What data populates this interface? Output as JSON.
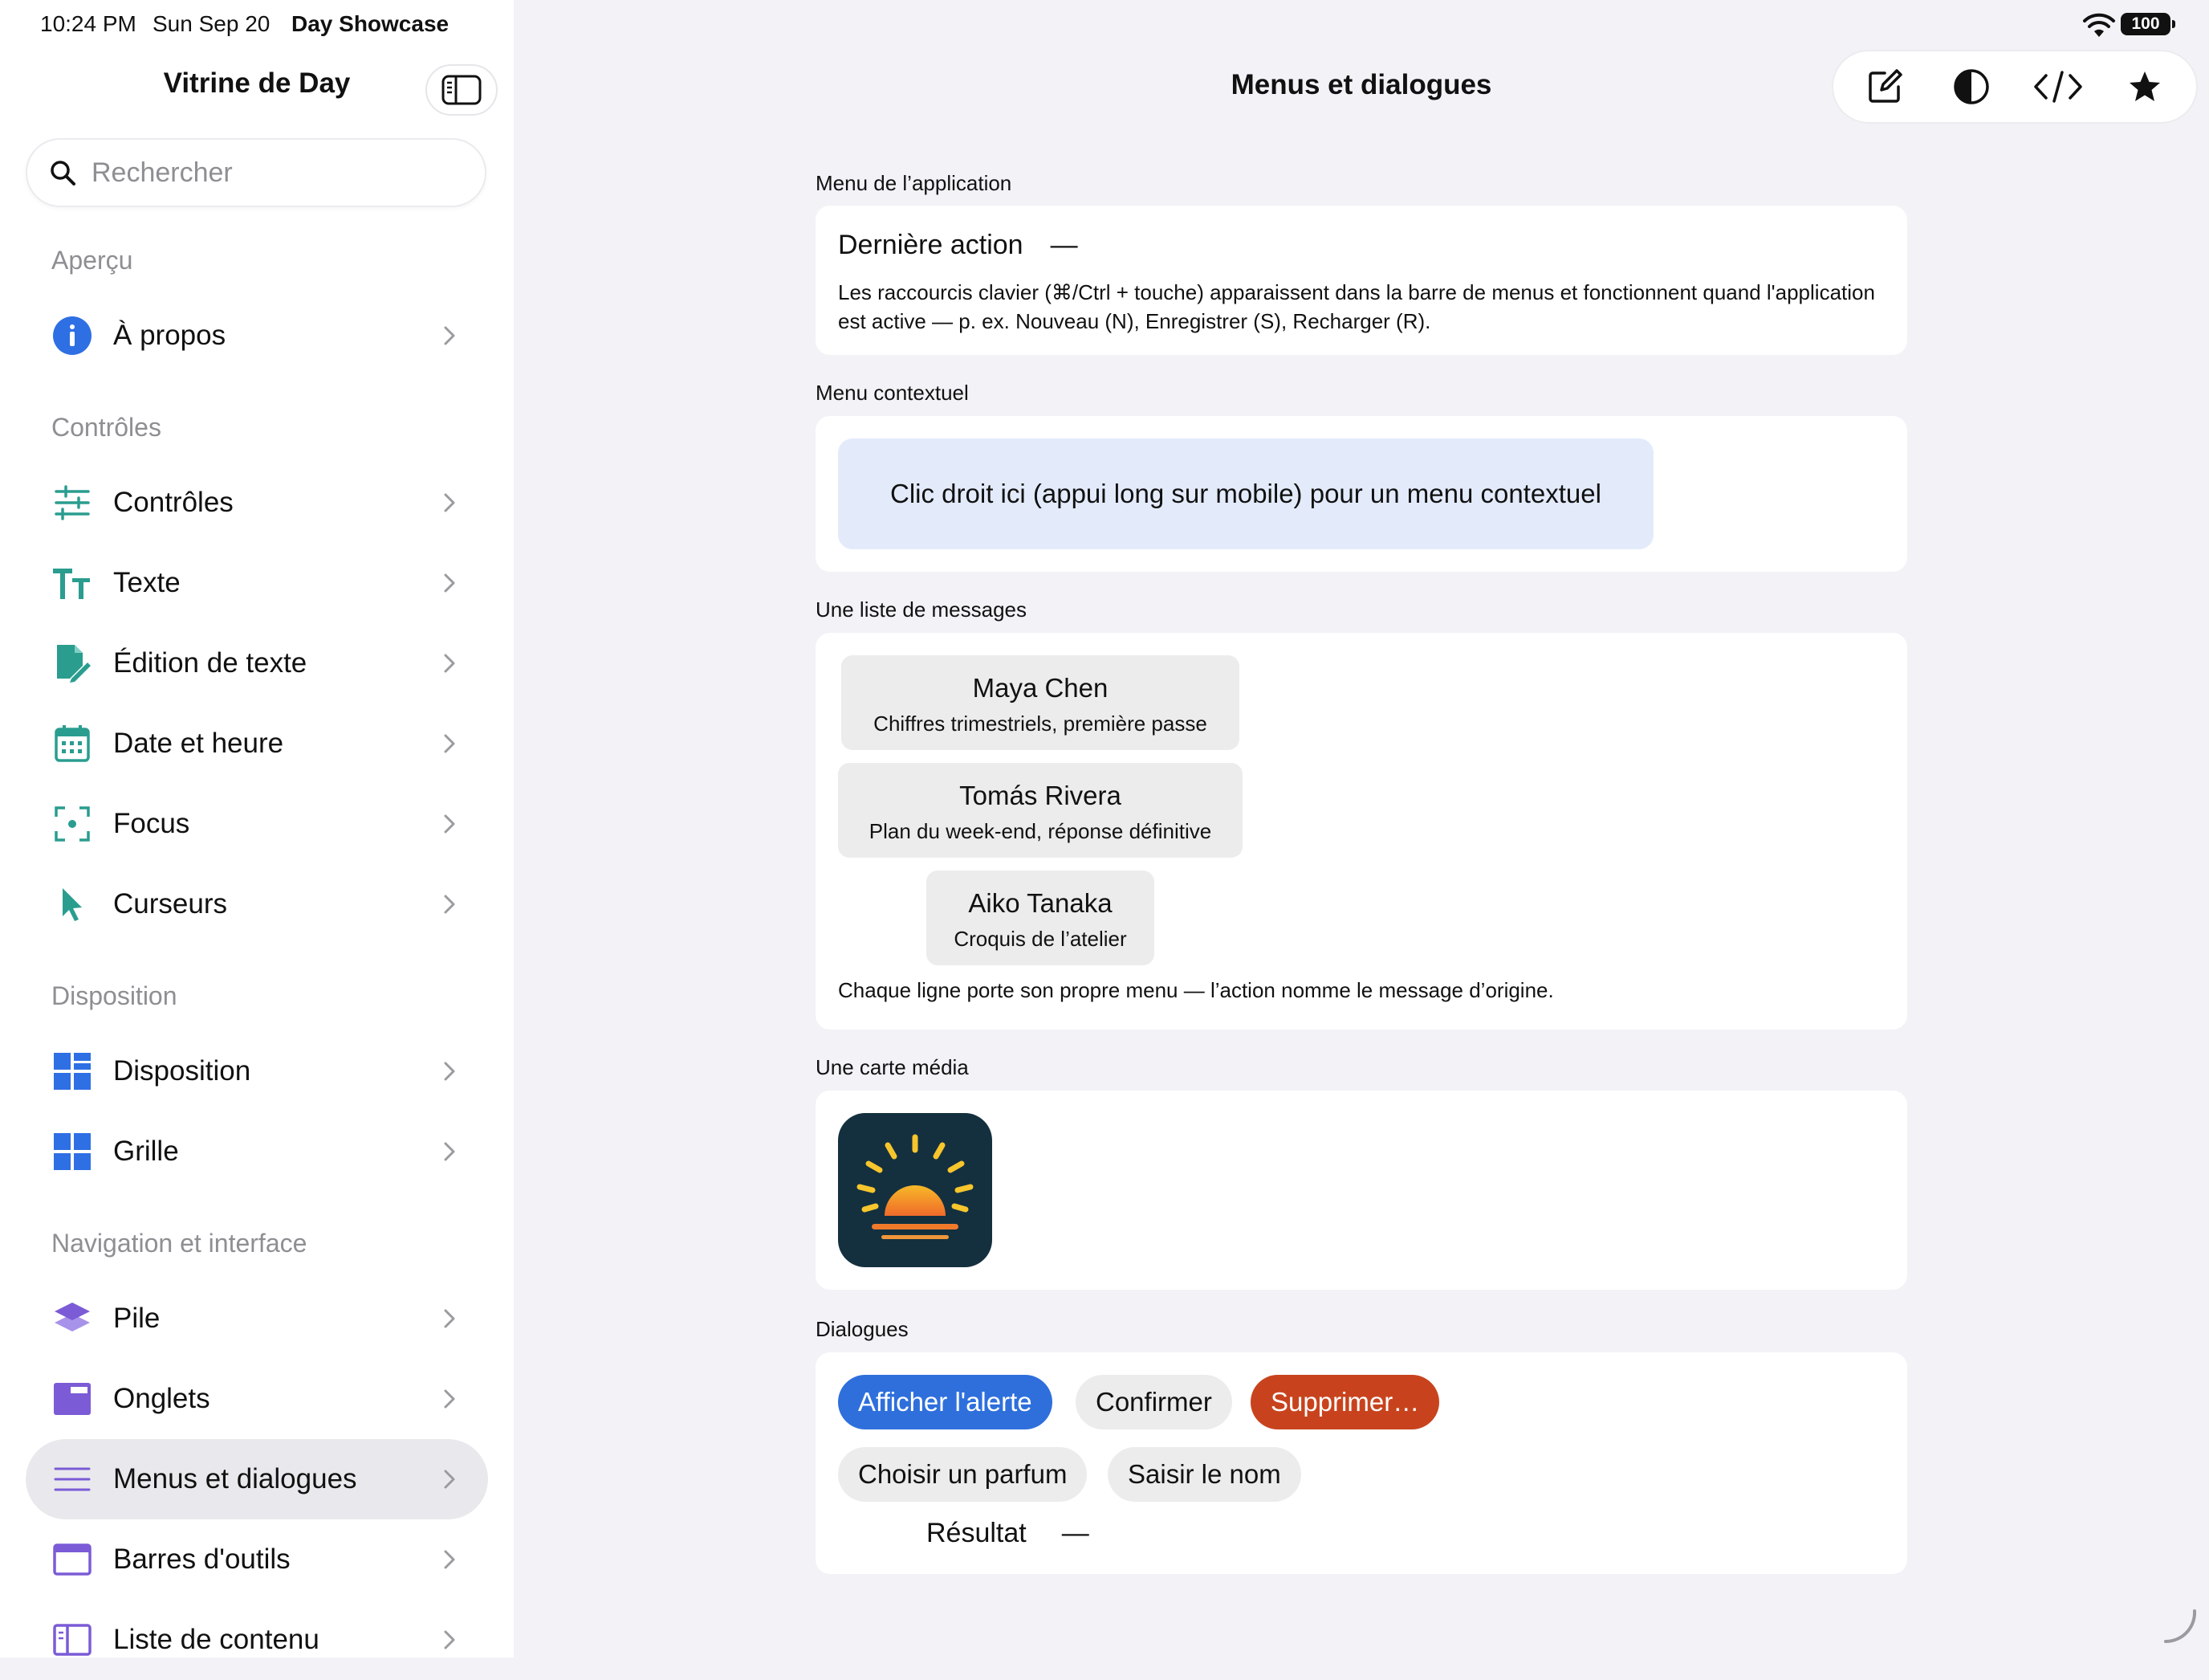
{
  "status_bar": {
    "time": "10:24 PM",
    "date": "Sun Sep 20",
    "app": "Day Showcase",
    "battery": "100"
  },
  "sidebar": {
    "title": "Vitrine de Day",
    "search_placeholder": "Rechercher",
    "sections": [
      {
        "header": "Aperçu",
        "items": [
          {
            "label": "À propos",
            "icon": "info-icon",
            "color": "#2f6fe4"
          }
        ]
      },
      {
        "header": "Contrôles",
        "items": [
          {
            "label": "Contrôles",
            "icon": "sliders-icon",
            "color": "#2a9d8f"
          },
          {
            "label": "Texte",
            "icon": "text-size-icon",
            "color": "#2a9d8f"
          },
          {
            "label": "Édition de texte",
            "icon": "document-edit-icon",
            "color": "#2a9d8f"
          },
          {
            "label": "Date et heure",
            "icon": "calendar-icon",
            "color": "#2a9d8f"
          },
          {
            "label": "Focus",
            "icon": "focus-icon",
            "color": "#2a9d8f"
          },
          {
            "label": "Curseurs",
            "icon": "cursor-icon",
            "color": "#2a9d8f"
          }
        ]
      },
      {
        "header": "Disposition",
        "items": [
          {
            "label": "Disposition",
            "icon": "layout-icon",
            "color": "#2f6fe4"
          },
          {
            "label": "Grille",
            "icon": "grid-icon",
            "color": "#2f6fe4"
          }
        ]
      },
      {
        "header": "Navigation et interface",
        "items": [
          {
            "label": "Pile",
            "icon": "stack-icon",
            "color": "#7b5bd6"
          },
          {
            "label": "Onglets",
            "icon": "tabs-icon",
            "color": "#7b5bd6"
          },
          {
            "label": "Menus et dialogues",
            "icon": "menu-lines-icon",
            "color": "#7b5bd6",
            "selected": true
          },
          {
            "label": "Barres d'outils",
            "icon": "toolbar-icon",
            "color": "#7b5bd6"
          },
          {
            "label": "Liste de contenu",
            "icon": "content-list-icon",
            "color": "#7b5bd6"
          }
        ]
      }
    ]
  },
  "main": {
    "title": "Menus et dialogues",
    "toolbar_icons": [
      "compose-icon",
      "contrast-icon",
      "code-icon",
      "star-icon"
    ],
    "app_menu": {
      "label": "Menu de l’application",
      "last_action_label": "Dernière action",
      "last_action_value": "—",
      "description": "Les raccourcis clavier (⌘/Ctrl + touche) apparaissent dans la barre de menus et fonctionnent quand l'application est active — p. ex. Nouveau (N), Enregistrer (S), Recharger (R)."
    },
    "context_menu": {
      "label": "Menu contextuel",
      "area_text": "Clic droit ici (appui long sur mobile) pour un menu contextuel"
    },
    "messages": {
      "label": "Une liste de messages",
      "items": [
        {
          "name": "Maya Chen",
          "subject": "Chiffres trimestriels, première passe"
        },
        {
          "name": "Tomás Rivera",
          "subject": "Plan du week-end, réponse définitive"
        },
        {
          "name": "Aiko Tanaka",
          "subject": "Croquis de l’atelier"
        }
      ],
      "note": "Chaque ligne porte son propre menu — l’action nomme le message d’origine."
    },
    "media": {
      "label": "Une carte média",
      "image_icon": "sunrise-icon"
    },
    "dialogs": {
      "label": "Dialogues",
      "buttons": {
        "alert": "Afficher l'alerte",
        "confirm": "Confirmer",
        "delete": "Supprimer…",
        "flavor": "Choisir un parfum",
        "name": "Saisir le nom"
      },
      "result_label": "Résultat",
      "result_value": "—"
    }
  },
  "colors": {
    "accent_blue": "#2e6fdc",
    "destructive": "#c8431d",
    "teal": "#2a9d8f",
    "purple": "#7b5bd6",
    "context_bg": "#e3ebfb"
  }
}
